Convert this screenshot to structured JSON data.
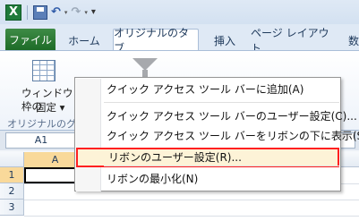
{
  "quick_access": {
    "app_icon": "X",
    "undo_symbol": "↶",
    "redo_symbol": "↷",
    "customize_symbol": "▾"
  },
  "tabs": {
    "file": "ファイル",
    "home": "ホーム",
    "original": "オリジナルのタブ",
    "insert": "挿入",
    "page_layout": "ページ レイアウト",
    "formula": "数"
  },
  "ribbon": {
    "freeze_line1": "ウィンドウ枠の",
    "freeze_line2": "固定 ▾",
    "group_label": "オリジナルのグル"
  },
  "formula_bar": {
    "name_box": "A1"
  },
  "grid": {
    "column_a": "A",
    "rows": [
      "1",
      "2",
      "3"
    ]
  },
  "context_menu": {
    "items": [
      "クイック アクセス ツール バーに追加(A)",
      "クイック アクセス ツール バーのユーザー設定(C)...",
      "クイック アクセス ツール バーをリボンの下に表示(S)",
      "リボンのユーザー設定(R)...",
      "リボンの最小化(N)"
    ]
  },
  "colors": {
    "file_tab": "#1c6a26",
    "highlight_border": "#ff2020",
    "highlight_fill": "#fdf3d7"
  }
}
